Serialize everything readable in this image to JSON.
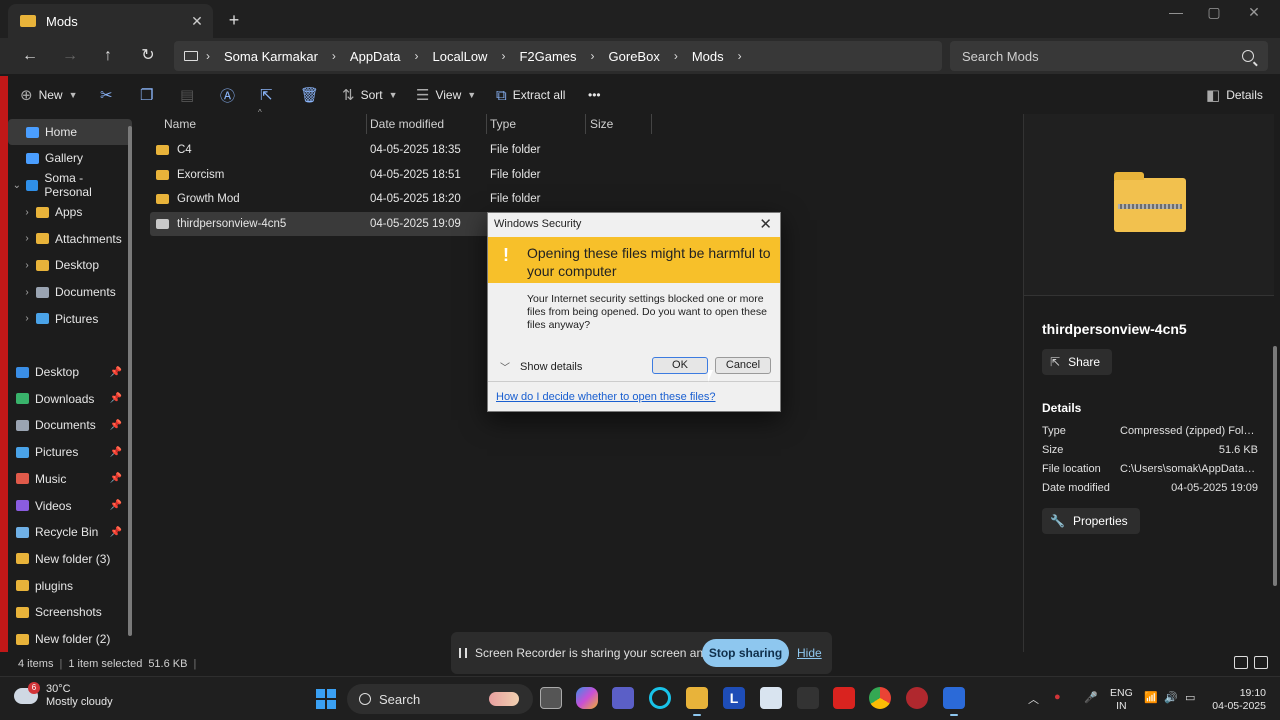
{
  "window": {
    "tab_title": "Mods",
    "new_tab": "+",
    "minimize": "—",
    "maximize": "▢",
    "close": "✕"
  },
  "address": {
    "crumbs": [
      "Soma Karmakar",
      "AppData",
      "LocalLow",
      "F2Games",
      "GoreBox",
      "Mods"
    ],
    "search_placeholder": "Search Mods"
  },
  "toolbar": {
    "new_label": "New",
    "sort_label": "Sort",
    "view_label": "View",
    "extract_label": "Extract all",
    "more_label": "•••",
    "details_label": "Details"
  },
  "sidebar": {
    "top": [
      {
        "label": "Home",
        "color": "#4a9eff"
      },
      {
        "label": "Gallery",
        "color": "#4a9eff"
      },
      {
        "label": "Soma - Personal",
        "color": "#2f8fe8"
      }
    ],
    "tree": [
      {
        "label": "Apps",
        "color": "#e8b33a"
      },
      {
        "label": "Attachments",
        "color": "#e8b33a"
      },
      {
        "label": "Desktop",
        "color": "#e8b33a"
      },
      {
        "label": "Documents",
        "color": "#9aa4b2"
      },
      {
        "label": "Pictures",
        "color": "#4aa3e8"
      }
    ],
    "quick": [
      {
        "label": "Desktop",
        "color": "#3a8ee6",
        "pinned": true
      },
      {
        "label": "Downloads",
        "color": "#39b36b",
        "pinned": true
      },
      {
        "label": "Documents",
        "color": "#9aa4b2",
        "pinned": true
      },
      {
        "label": "Pictures",
        "color": "#4aa3e8",
        "pinned": true
      },
      {
        "label": "Music",
        "color": "#e05a4a",
        "pinned": true
      },
      {
        "label": "Videos",
        "color": "#8a5ce0",
        "pinned": true
      },
      {
        "label": "Recycle Bin",
        "color": "#6fb0e6",
        "pinned": true
      },
      {
        "label": "New folder (3)",
        "color": "#e8b33a",
        "pinned": false
      },
      {
        "label": "plugins",
        "color": "#e8b33a",
        "pinned": false
      },
      {
        "label": "Screenshots",
        "color": "#e8b33a",
        "pinned": false
      },
      {
        "label": "New folder (2)",
        "color": "#e8b33a",
        "pinned": false
      }
    ]
  },
  "filelist": {
    "columns": [
      "Name",
      "Date modified",
      "Type",
      "Size"
    ],
    "rows": [
      {
        "name": "C4",
        "date": "04-05-2025 18:35",
        "type": "File folder",
        "zip": false
      },
      {
        "name": "Exorcism",
        "date": "04-05-2025 18:51",
        "type": "File folder",
        "zip": false
      },
      {
        "name": "Growth Mod",
        "date": "04-05-2025 18:20",
        "type": "File folder",
        "zip": false
      },
      {
        "name": "thirdpersonview-4cn5",
        "date": "04-05-2025 19:09",
        "type": "",
        "zip": true
      }
    ]
  },
  "details": {
    "name": "thirdpersonview-4cn5",
    "share_label": "Share",
    "section": "Details",
    "props": [
      {
        "k": "Type",
        "v": "Compressed (zipped) Folder"
      },
      {
        "k": "Size",
        "v": "51.6 KB"
      },
      {
        "k": "File location",
        "v": "C:\\Users\\somak\\AppData\\Loc..."
      },
      {
        "k": "Date modified",
        "v": "04-05-2025 19:09"
      }
    ],
    "properties_label": "Properties"
  },
  "status": {
    "items": "4 items",
    "selected": "1 item selected",
    "size": "51.6 KB"
  },
  "dialog": {
    "title": "Windows Security",
    "close": "✕",
    "warn_glyph": "!",
    "heading": "Opening these files might be harmful to your computer",
    "message": "Your Internet security settings blocked one or more files from being opened. Do you want to open these files anyway?",
    "show_details": "Show details",
    "ok": "OK",
    "cancel": "Cancel",
    "link": "How do I decide whether to open these files?"
  },
  "sharebar": {
    "text": "Screen Recorder is sharing your screen and audio.",
    "stop": "Stop sharing",
    "hide": "Hide"
  },
  "taskbar": {
    "badge": "6",
    "temp": "30°C",
    "weather": "Mostly cloudy",
    "search": "Search",
    "lang_top": "ENG",
    "lang_bottom": "IN",
    "time": "19:10",
    "date": "04-05-2025"
  }
}
